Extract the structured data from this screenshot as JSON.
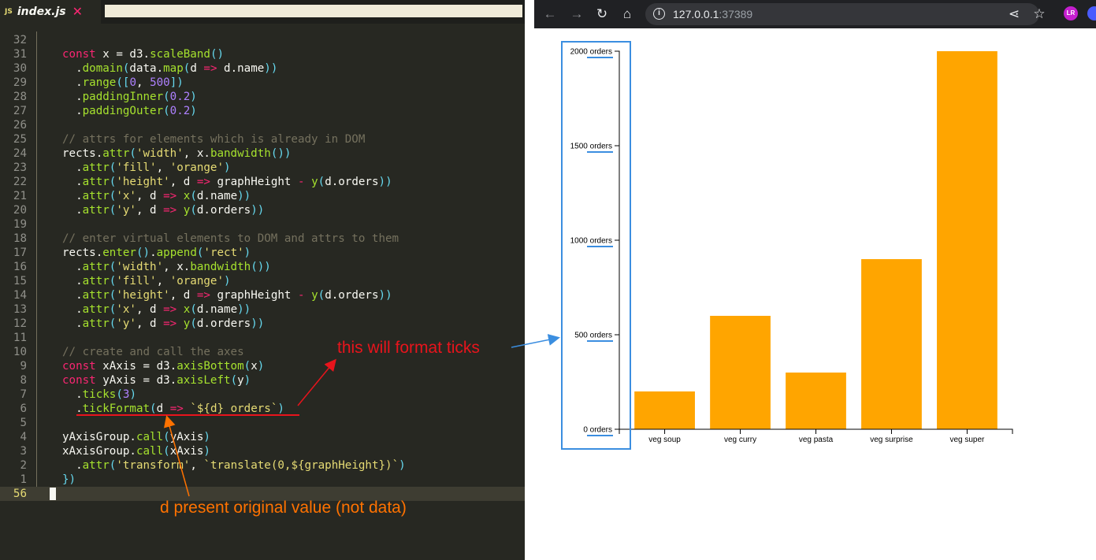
{
  "editor": {
    "tab": {
      "icon_label": "JS",
      "file_name": "index.js"
    },
    "lines": [
      {
        "n": "32",
        "parts": []
      },
      {
        "n": "31",
        "parts": [
          [
            "kw",
            "const"
          ],
          [
            "pl",
            " x = d3."
          ],
          [
            "fn",
            "scaleBand"
          ],
          [
            "pn",
            "()"
          ]
        ]
      },
      {
        "n": "30",
        "parts": [
          [
            "pl",
            "  ."
          ],
          [
            "fn",
            "domain"
          ],
          [
            "pn",
            "("
          ],
          [
            "pl",
            "data."
          ],
          [
            "fn",
            "map"
          ],
          [
            "pn",
            "("
          ],
          [
            "pl",
            "d "
          ],
          [
            "kw",
            "=>"
          ],
          [
            "pl",
            " d.name"
          ],
          [
            "pn",
            "))"
          ]
        ]
      },
      {
        "n": "29",
        "parts": [
          [
            "pl",
            "  ."
          ],
          [
            "fn",
            "range"
          ],
          [
            "pn",
            "(["
          ],
          [
            "num",
            "0"
          ],
          [
            "pl",
            ", "
          ],
          [
            "num",
            "500"
          ],
          [
            "pn",
            "])"
          ]
        ]
      },
      {
        "n": "28",
        "parts": [
          [
            "pl",
            "  ."
          ],
          [
            "fn",
            "paddingInner"
          ],
          [
            "pn",
            "("
          ],
          [
            "num",
            "0.2"
          ],
          [
            "pn",
            ")"
          ]
        ]
      },
      {
        "n": "27",
        "parts": [
          [
            "pl",
            "  ."
          ],
          [
            "fn",
            "paddingOuter"
          ],
          [
            "pn",
            "("
          ],
          [
            "num",
            "0.2"
          ],
          [
            "pn",
            ")"
          ]
        ]
      },
      {
        "n": "26",
        "parts": []
      },
      {
        "n": "25",
        "parts": [
          [
            "cm",
            "// attrs for elements which is already in DOM"
          ]
        ]
      },
      {
        "n": "24",
        "parts": [
          [
            "pl",
            "rects."
          ],
          [
            "fn",
            "attr"
          ],
          [
            "pn",
            "("
          ],
          [
            "str",
            "'width'"
          ],
          [
            "pl",
            ", x."
          ],
          [
            "fn",
            "bandwidth"
          ],
          [
            "pn",
            "())"
          ]
        ]
      },
      {
        "n": "23",
        "parts": [
          [
            "pl",
            "  ."
          ],
          [
            "fn",
            "attr"
          ],
          [
            "pn",
            "("
          ],
          [
            "str",
            "'fill'"
          ],
          [
            "pl",
            ", "
          ],
          [
            "str",
            "'orange'"
          ],
          [
            "pn",
            ")"
          ]
        ]
      },
      {
        "n": "22",
        "parts": [
          [
            "pl",
            "  ."
          ],
          [
            "fn",
            "attr"
          ],
          [
            "pn",
            "("
          ],
          [
            "str",
            "'height'"
          ],
          [
            "pl",
            ", d "
          ],
          [
            "kw",
            "=>"
          ],
          [
            "pl",
            " graphHeight "
          ],
          [
            "kw",
            "-"
          ],
          [
            "pl",
            " "
          ],
          [
            "fn",
            "y"
          ],
          [
            "pn",
            "("
          ],
          [
            "pl",
            "d.orders"
          ],
          [
            "pn",
            "))"
          ]
        ]
      },
      {
        "n": "21",
        "parts": [
          [
            "pl",
            "  ."
          ],
          [
            "fn",
            "attr"
          ],
          [
            "pn",
            "("
          ],
          [
            "str",
            "'x'"
          ],
          [
            "pl",
            ", d "
          ],
          [
            "kw",
            "=>"
          ],
          [
            "pl",
            " "
          ],
          [
            "fn",
            "x"
          ],
          [
            "pn",
            "("
          ],
          [
            "pl",
            "d.name"
          ],
          [
            "pn",
            "))"
          ]
        ]
      },
      {
        "n": "20",
        "parts": [
          [
            "pl",
            "  ."
          ],
          [
            "fn",
            "attr"
          ],
          [
            "pn",
            "("
          ],
          [
            "str",
            "'y'"
          ],
          [
            "pl",
            ", d "
          ],
          [
            "kw",
            "=>"
          ],
          [
            "pl",
            " "
          ],
          [
            "fn",
            "y"
          ],
          [
            "pn",
            "("
          ],
          [
            "pl",
            "d.orders"
          ],
          [
            "pn",
            "))"
          ]
        ]
      },
      {
        "n": "19",
        "parts": []
      },
      {
        "n": "18",
        "parts": [
          [
            "cm",
            "// enter virtual elements to DOM and attrs to them"
          ]
        ]
      },
      {
        "n": "17",
        "parts": [
          [
            "pl",
            "rects."
          ],
          [
            "fn",
            "enter"
          ],
          [
            "pn",
            "()"
          ],
          [
            "pl",
            "."
          ],
          [
            "fn",
            "append"
          ],
          [
            "pn",
            "("
          ],
          [
            "str",
            "'rect'"
          ],
          [
            "pn",
            ")"
          ]
        ]
      },
      {
        "n": "16",
        "parts": [
          [
            "pl",
            "  ."
          ],
          [
            "fn",
            "attr"
          ],
          [
            "pn",
            "("
          ],
          [
            "str",
            "'width'"
          ],
          [
            "pl",
            ", x."
          ],
          [
            "fn",
            "bandwidth"
          ],
          [
            "pn",
            "())"
          ]
        ]
      },
      {
        "n": "15",
        "parts": [
          [
            "pl",
            "  ."
          ],
          [
            "fn",
            "attr"
          ],
          [
            "pn",
            "("
          ],
          [
            "str",
            "'fill'"
          ],
          [
            "pl",
            ", "
          ],
          [
            "str",
            "'orange'"
          ],
          [
            "pn",
            ")"
          ]
        ]
      },
      {
        "n": "14",
        "parts": [
          [
            "pl",
            "  ."
          ],
          [
            "fn",
            "attr"
          ],
          [
            "pn",
            "("
          ],
          [
            "str",
            "'height'"
          ],
          [
            "pl",
            ", d "
          ],
          [
            "kw",
            "=>"
          ],
          [
            "pl",
            " graphHeight "
          ],
          [
            "kw",
            "-"
          ],
          [
            "pl",
            " "
          ],
          [
            "fn",
            "y"
          ],
          [
            "pn",
            "("
          ],
          [
            "pl",
            "d.orders"
          ],
          [
            "pn",
            "))"
          ]
        ]
      },
      {
        "n": "13",
        "parts": [
          [
            "pl",
            "  ."
          ],
          [
            "fn",
            "attr"
          ],
          [
            "pn",
            "("
          ],
          [
            "str",
            "'x'"
          ],
          [
            "pl",
            ", d "
          ],
          [
            "kw",
            "=>"
          ],
          [
            "pl",
            " "
          ],
          [
            "fn",
            "x"
          ],
          [
            "pn",
            "("
          ],
          [
            "pl",
            "d.name"
          ],
          [
            "pn",
            "))"
          ]
        ]
      },
      {
        "n": "12",
        "parts": [
          [
            "pl",
            "  ."
          ],
          [
            "fn",
            "attr"
          ],
          [
            "pn",
            "("
          ],
          [
            "str",
            "'y'"
          ],
          [
            "pl",
            ", d "
          ],
          [
            "kw",
            "=>"
          ],
          [
            "pl",
            " "
          ],
          [
            "fn",
            "y"
          ],
          [
            "pn",
            "("
          ],
          [
            "pl",
            "d.orders"
          ],
          [
            "pn",
            "))"
          ]
        ]
      },
      {
        "n": "11",
        "parts": []
      },
      {
        "n": "10",
        "parts": [
          [
            "cm",
            "// create and call the axes"
          ]
        ]
      },
      {
        "n": "9",
        "parts": [
          [
            "kw",
            "const"
          ],
          [
            "pl",
            " xAxis = d3."
          ],
          [
            "fn",
            "axisBottom"
          ],
          [
            "pn",
            "("
          ],
          [
            "pl",
            "x"
          ],
          [
            "pn",
            ")"
          ]
        ]
      },
      {
        "n": "8",
        "parts": [
          [
            "kw",
            "const"
          ],
          [
            "pl",
            " yAxis = d3."
          ],
          [
            "fn",
            "axisLeft"
          ],
          [
            "pn",
            "("
          ],
          [
            "pl",
            "y"
          ],
          [
            "pn",
            ")"
          ]
        ]
      },
      {
        "n": "7",
        "parts": [
          [
            "pl",
            "  ."
          ],
          [
            "fn",
            "ticks"
          ],
          [
            "pn",
            "("
          ],
          [
            "num",
            "3"
          ],
          [
            "pn",
            ")"
          ]
        ]
      },
      {
        "n": "6",
        "parts": [
          [
            "pl",
            "  ."
          ],
          [
            "fn",
            "tickFormat"
          ],
          [
            "pn",
            "("
          ],
          [
            "pl",
            "d "
          ],
          [
            "kw",
            "=>"
          ],
          [
            "pl",
            " "
          ],
          [
            "str",
            "`${d} orders`"
          ],
          [
            "pn",
            ")"
          ]
        ]
      },
      {
        "n": "5",
        "parts": []
      },
      {
        "n": "4",
        "parts": [
          [
            "pl",
            "yAxisGroup."
          ],
          [
            "fn",
            "call"
          ],
          [
            "pn",
            "("
          ],
          [
            "pl",
            "yAxis"
          ],
          [
            "pn",
            ")"
          ]
        ]
      },
      {
        "n": "3",
        "parts": [
          [
            "pl",
            "xAxisGroup."
          ],
          [
            "fn",
            "call"
          ],
          [
            "pn",
            "("
          ],
          [
            "pl",
            "xAxis"
          ],
          [
            "pn",
            ")"
          ]
        ]
      },
      {
        "n": "2",
        "parts": [
          [
            "pl",
            "  ."
          ],
          [
            "fn",
            "attr"
          ],
          [
            "pn",
            "("
          ],
          [
            "str",
            "'transform'"
          ],
          [
            "pl",
            ", "
          ],
          [
            "str",
            "`translate(0,${graphHeight})`"
          ],
          [
            "pn",
            ")"
          ]
        ]
      },
      {
        "n": "1",
        "parts": [
          [
            "pn",
            "})"
          ]
        ]
      },
      {
        "n": "56",
        "parts": [],
        "active": true
      }
    ]
  },
  "annotations": {
    "ticks_note": "this will format ticks",
    "d_note": "d present original value (not data)"
  },
  "browser": {
    "url_host": "127.0.0.1",
    "url_port": ":37389",
    "extension_label": "LR"
  },
  "colors": {
    "bar": "#ffa500",
    "annotation_red": "#e8141c",
    "annotation_orange": "#ff7200",
    "highlight_blue": "#3b8ee0"
  },
  "chart_data": {
    "type": "bar",
    "categories": [
      "veg soup",
      "veg curry",
      "veg pasta",
      "veg surprise",
      "veg super"
    ],
    "values": [
      200,
      600,
      300,
      900,
      2000
    ],
    "ylim": [
      0,
      2000
    ],
    "yticks": [
      0,
      500,
      1000,
      1500,
      2000
    ],
    "ytick_labels": [
      "0 orders",
      "500 orders",
      "1000 orders",
      "1500 orders",
      "2000 orders"
    ],
    "title": "",
    "xlabel": "",
    "ylabel": "",
    "grid": false
  }
}
